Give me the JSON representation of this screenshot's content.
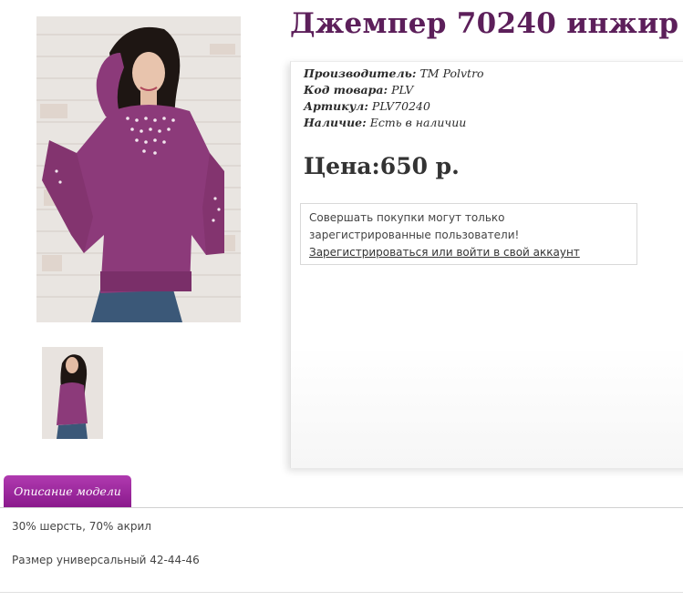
{
  "product": {
    "title": "Джемпер 70240 инжир",
    "main_image_alt": "Джемпер 70240 инжир",
    "thumbnail_alt": "Джемпер 70240 инжир"
  },
  "specs": [
    {
      "label": "Производитель:",
      "value": "TM Polvtro"
    },
    {
      "label": "Код товара:",
      "value": "PLV"
    },
    {
      "label": "Артикул:",
      "value": "PLV70240"
    },
    {
      "label": "Наличие:",
      "value": "Есть в наличии"
    }
  ],
  "price": {
    "label": "Цена:",
    "value": "650 р."
  },
  "notice": {
    "text": "Совершать покупки могут только зарегистрированные пользователи!",
    "link": "Зарегистрироваться или войти в свой аккаунт"
  },
  "tabs": [
    {
      "label": "Описание модели"
    }
  ],
  "description": [
    "30% шерсть, 70% акрил",
    "Размер универсальный 42-44-46"
  ],
  "colors": {
    "title": "#5c1f5a",
    "tab": "#9b249d",
    "sweater": "#8c3a7a"
  }
}
